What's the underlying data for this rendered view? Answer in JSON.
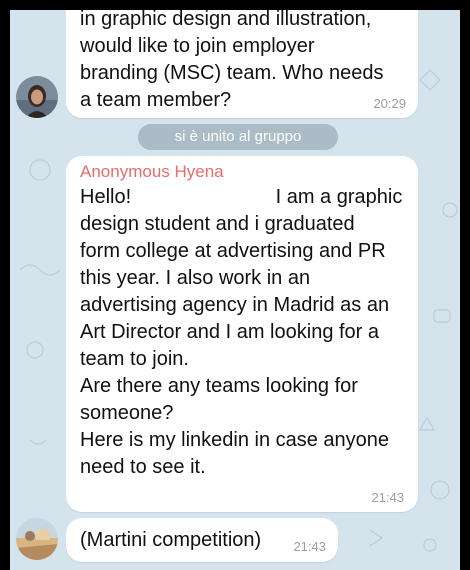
{
  "messages": [
    {
      "text": "in graphic design and illustration,\nwould like to join employer\nbranding (MSC) team. Who needs\na team member?",
      "time": "20:29"
    },
    {
      "sender": "Anonymous Hyena",
      "text": "Hello!                          I am a graphic\ndesign student and i graduated\nform college at advertising and PR\nthis year. I also work in an\nadvertising agency in Madrid as an\nArt Director and I am looking for a\nteam to join.\nAre there any teams looking for\nsomeone?\nHere is my linkedin in case anyone\nneed to see it.",
      "time": "21:43"
    },
    {
      "text": "(Martini competition)",
      "time": "21:43"
    }
  ],
  "system_message": "si è unito al gruppo",
  "colors": {
    "chat_background": "#d5e3ec",
    "bubble": "#ffffff",
    "sender_name": "#e96b6b",
    "timestamp": "#9aa0a6"
  },
  "icons": [
    "avatar-woman-photo",
    "avatar-landscape-photo"
  ]
}
